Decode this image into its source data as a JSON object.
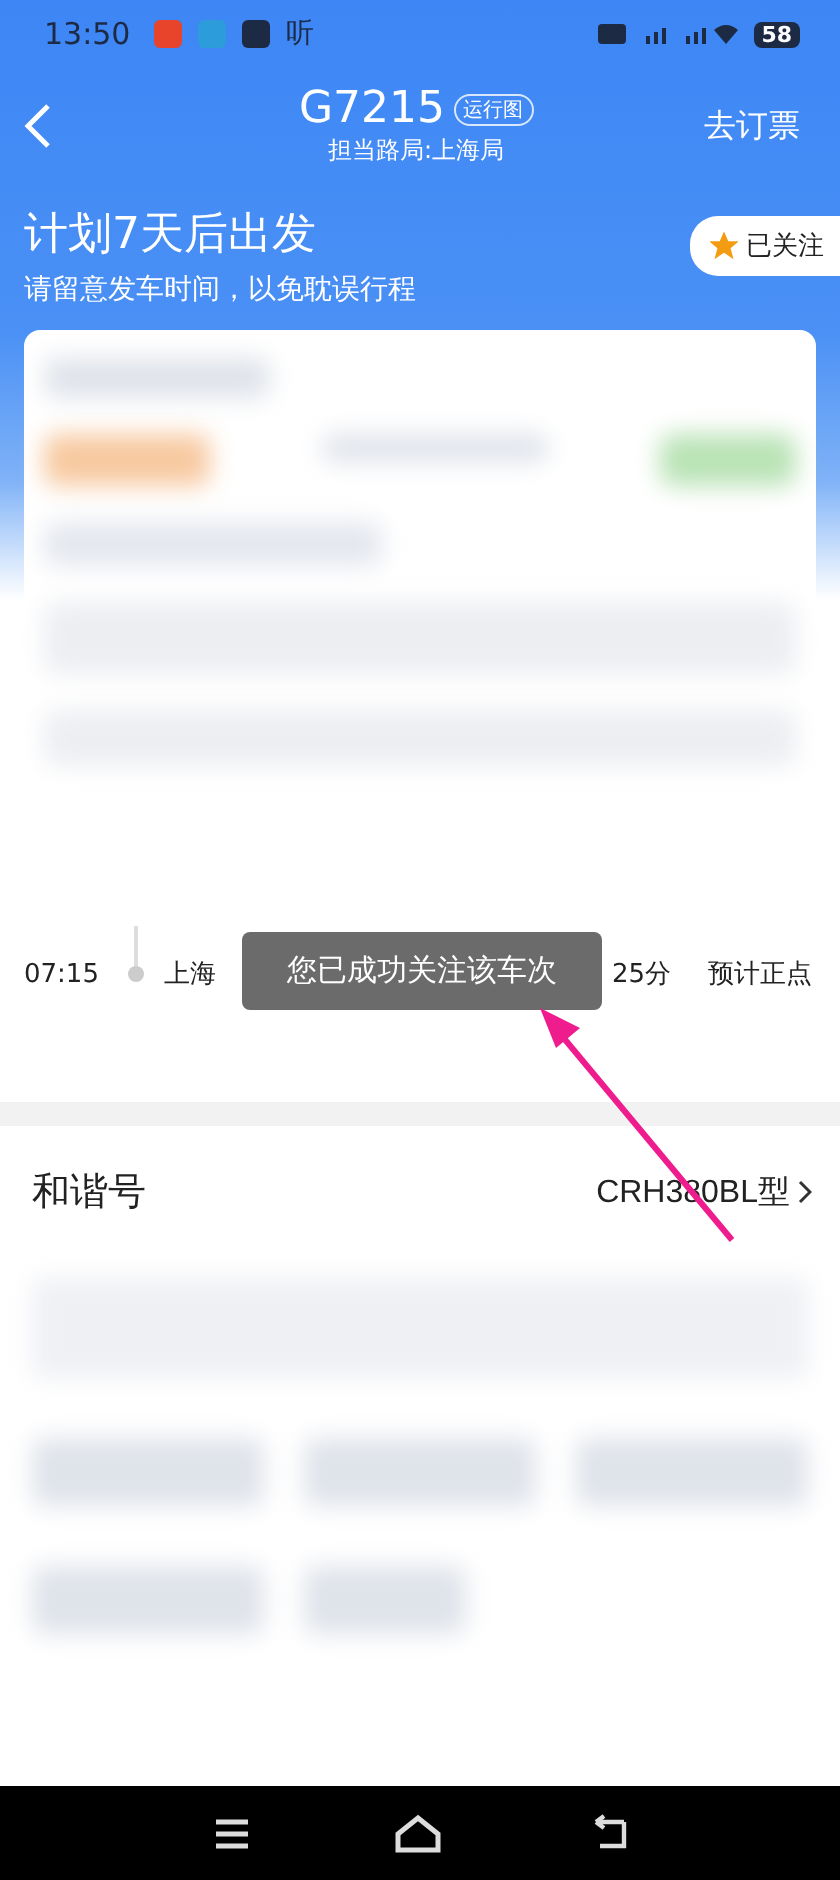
{
  "status_bar": {
    "time": "13:50",
    "app_label": "听",
    "battery": "58"
  },
  "header": {
    "title": "G7215",
    "badge": "运行图",
    "subtitle": "担当路局:上海局",
    "action": "去订票"
  },
  "banner": {
    "heading": "计划7天后出发",
    "note": "请留意发车时间，以免耽误行程",
    "follow": {
      "label": "已关注",
      "selected": true
    }
  },
  "stop": {
    "time": "07:15",
    "station": "上海",
    "duration": "25分",
    "status": "预计正点"
  },
  "toast": "您已成功关注该车次",
  "train": {
    "name": "和谐号",
    "model": "CRH380BL型"
  }
}
